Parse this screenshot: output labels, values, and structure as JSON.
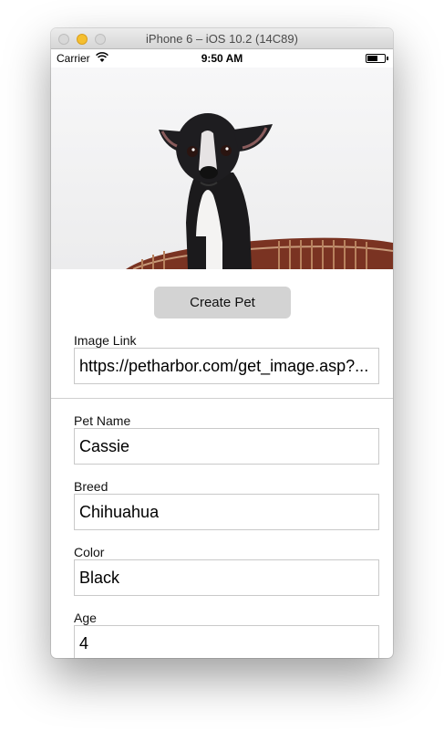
{
  "window": {
    "title": "iPhone 6 – iOS 10.2 (14C89)"
  },
  "status_bar": {
    "carrier": "Carrier",
    "time": "9:50 AM",
    "wifi_icon": "wifi-icon",
    "battery_icon": "battery-icon"
  },
  "photo": {
    "description_icon": "pet-photo"
  },
  "form": {
    "create_button": "Create Pet",
    "image_link": {
      "label": "Image Link",
      "value": "https://petharbor.com/get_image.asp?..."
    },
    "pet_name": {
      "label": "Pet Name",
      "value": "Cassie"
    },
    "breed": {
      "label": "Breed",
      "value": "Chihuahua"
    },
    "color": {
      "label": "Color",
      "value": "Black"
    },
    "age": {
      "label": "Age",
      "value": "4"
    }
  },
  "colors": {
    "button_bg": "#d3d3d3",
    "field_border": "#c9c9c9",
    "accent_yellow": "#f5bf2f"
  }
}
